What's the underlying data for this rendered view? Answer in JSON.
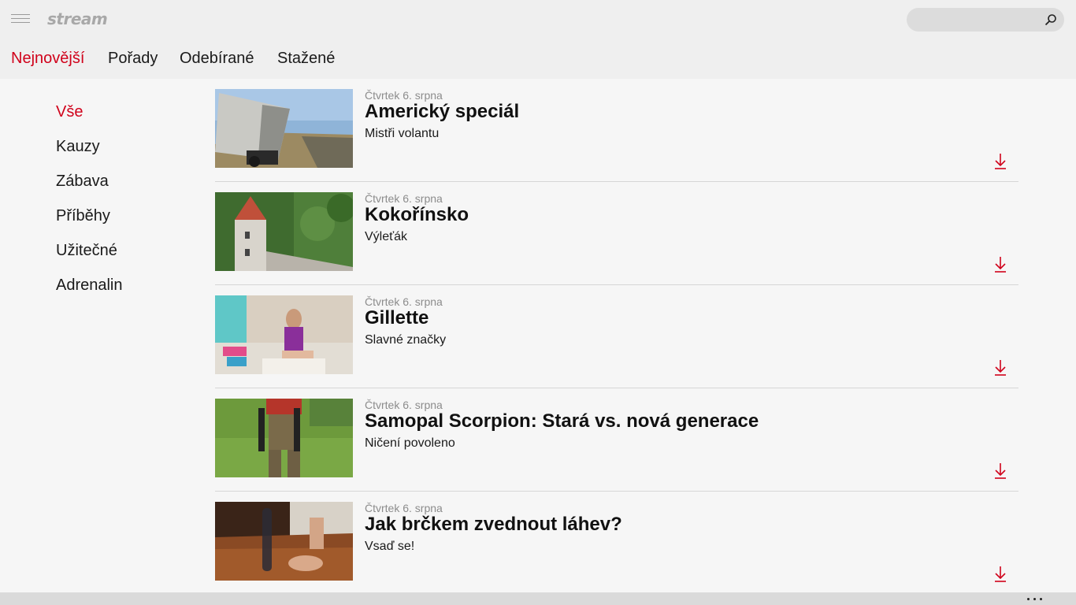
{
  "app": {
    "logo": "stream"
  },
  "search": {
    "value": "",
    "placeholder": "",
    "icon": "search-icon"
  },
  "tabs": [
    {
      "label": "Nejnovější",
      "active": true
    },
    {
      "label": "Pořady",
      "active": false
    },
    {
      "label": "Odebírané",
      "active": false
    },
    {
      "label": "Stažené",
      "active": false
    }
  ],
  "sidebar": {
    "items": [
      {
        "label": "Vše",
        "active": true
      },
      {
        "label": "Kauzy",
        "active": false
      },
      {
        "label": "Zábava",
        "active": false
      },
      {
        "label": "Příběhy",
        "active": false
      },
      {
        "label": "Užitečné",
        "active": false
      },
      {
        "label": "Adrenalin",
        "active": false
      }
    ]
  },
  "videos": [
    {
      "date": "Čtvrtek 6. srpna",
      "title": "Americký speciál",
      "show": "Mistři volantu"
    },
    {
      "date": "Čtvrtek 6. srpna",
      "title": "Kokořínsko",
      "show": "Výleťák"
    },
    {
      "date": "Čtvrtek 6. srpna",
      "title": "Gillette",
      "show": "Slavné značky"
    },
    {
      "date": "Čtvrtek 6. srpna",
      "title": "Samopal Scorpion: Stará vs. nová generace",
      "show": "Ničení povoleno"
    },
    {
      "date": "Čtvrtek 6. srpna",
      "title": "Jak brčkem zvednout láhev?",
      "show": "Vsaď se!"
    }
  ],
  "colors": {
    "accent": "#d0021b",
    "background": "#f6f6f6",
    "bar": "#efefef"
  }
}
